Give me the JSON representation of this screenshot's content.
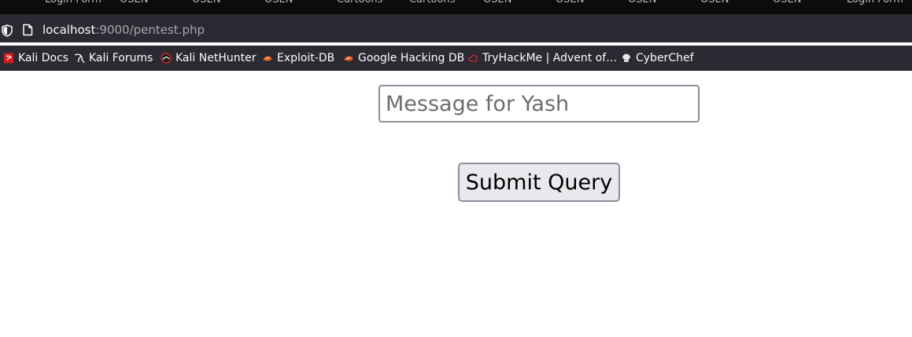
{
  "browser": {
    "tabs": [
      {
        "label": "Login Form"
      },
      {
        "label": "OSEN"
      },
      {
        "label": "OSEN"
      },
      {
        "label": "OSEN"
      },
      {
        "label": "Cartoons"
      },
      {
        "label": "Cartoons"
      },
      {
        "label": "OSEN"
      },
      {
        "label": "OSEN"
      },
      {
        "label": "OSEN"
      },
      {
        "label": "OSEN"
      },
      {
        "label": "OSEN"
      },
      {
        "label": "Login Form"
      }
    ],
    "url": {
      "host": "localhost",
      "rest": ":9000/pentest.php"
    },
    "bookmarks": [
      {
        "label": "Kali Docs",
        "icon": "kali-docs-icon"
      },
      {
        "label": "Kali Forums",
        "icon": "kali-dragon-icon"
      },
      {
        "label": "Kali NetHunter",
        "icon": "nethunter-icon"
      },
      {
        "label": "Exploit-DB",
        "icon": "exploit-db-icon"
      },
      {
        "label": "Google Hacking DB",
        "icon": "exploit-db-icon"
      },
      {
        "label": "TryHackMe | Advent of…",
        "icon": "tryhackme-icon"
      },
      {
        "label": "CyberChef",
        "icon": "cyberchef-icon"
      }
    ],
    "colors": {
      "toolbar": "#2b2a33",
      "tabstrip": "#0c0c0d",
      "text": "#fbfbfe"
    }
  },
  "form": {
    "message_placeholder": "Message for Yash",
    "message_value": "",
    "submit_label": "Submit Query"
  }
}
